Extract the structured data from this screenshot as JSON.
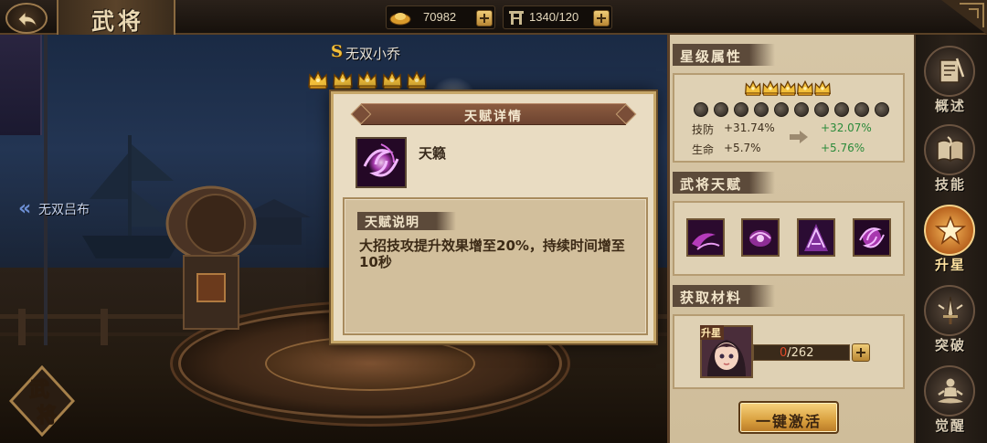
{
  "topbar": {
    "title": "武将",
    "gold": "70982",
    "stamina": "1340/120"
  },
  "hero": {
    "name": "无双小乔",
    "stars": 5,
    "prev_hero": "无双吕布",
    "badge": "武将"
  },
  "popup": {
    "title": "天赋详情",
    "skill_name": "天籁",
    "desc_label": "天赋说明",
    "desc_text": "大招技攻提升效果增至20%，持续时间增至10秒"
  },
  "star_attributes": {
    "title": "星级属性",
    "stars": 5,
    "rows": [
      {
        "label": "技防",
        "current": "+31.74%",
        "next": "+32.07%"
      },
      {
        "label": "生命",
        "current": "+5.7%",
        "next": "+5.76%"
      }
    ]
  },
  "talents": {
    "title": "武将天赋"
  },
  "materials": {
    "title": "获取材料",
    "tag": "升星",
    "current": "0",
    "total": "/262",
    "progress_fraction": 0,
    "activate_button": "一键激活"
  },
  "sidetabs": [
    {
      "label": "概述",
      "icon": "scroll-icon"
    },
    {
      "label": "技能",
      "icon": "book-icon"
    },
    {
      "label": "升星",
      "icon": "star-icon",
      "active": true
    },
    {
      "label": "突破",
      "icon": "sword-icon"
    },
    {
      "label": "觉醒",
      "icon": "meditation-icon"
    }
  ],
  "colors": {
    "accent_gold": "#f2bf3a",
    "stat_green": "#2a8a3a",
    "progress_red": "#e14a2a"
  }
}
